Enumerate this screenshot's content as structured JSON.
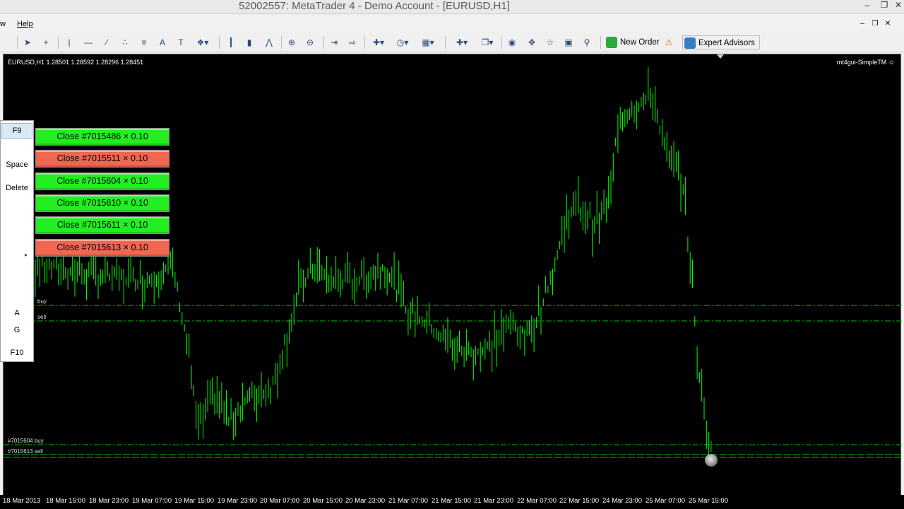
{
  "window": {
    "title": "52002557: MetaTrader 4 - Demo Account - [EURUSD,H1]",
    "minimize": "–",
    "restore": "❐",
    "close": "✕"
  },
  "menu": {
    "items": [
      "w",
      "Help"
    ]
  },
  "toolbar": {
    "new_order_label": "New Order",
    "expert_advisors_label": "Expert Advisors"
  },
  "chart": {
    "symbol_info": "EURUSD,H1  1.28501  1.28592  1.28296  1.28451",
    "ea_label": "mt4gui-SimpleTM ☺",
    "line_labels": {
      "buy": "buy",
      "sell": "sell",
      "order_buy": "#7015604 buy",
      "order_sell": "#7015613 sell"
    },
    "colors": {
      "background": "#000000",
      "bars": "#00ff00",
      "level_line": "#00c000"
    },
    "x_axis_labels": [
      "18 Mar 2013",
      "18 Mar 15:00",
      "18 Mar 23:00",
      "19 Mar 07:00",
      "19 Mar 15:00",
      "19 Mar 23:00",
      "20 Mar 07:00",
      "20 Mar 15:00",
      "20 Mar 23:00",
      "21 Mar 07:00",
      "21 Mar 15:00",
      "21 Mar 23:00",
      "22 Mar 07:00",
      "22 Mar 15:00",
      "24 Mar 23:00",
      "25 Mar 07:00",
      "25 Mar 15:00"
    ]
  },
  "shortcut_panel": {
    "keys": [
      "F9",
      "Space",
      "Delete",
      "A",
      "G",
      "F10"
    ],
    "submenu_arrow": "▸"
  },
  "close_buttons": [
    {
      "label": "Close #7015486 × 0.10",
      "color": "#22ee22"
    },
    {
      "label": "Close #7015511 × 0.10",
      "color": "#f06650"
    },
    {
      "label": "Close #7015604 × 0.10",
      "color": "#22ee22"
    },
    {
      "label": "Close #7015610 × 0.10",
      "color": "#22ee22"
    },
    {
      "label": "Close #7015611 × 0.10",
      "color": "#22ee22"
    },
    {
      "label": "Close #7015613 × 0.10",
      "color": "#f06650"
    }
  ]
}
